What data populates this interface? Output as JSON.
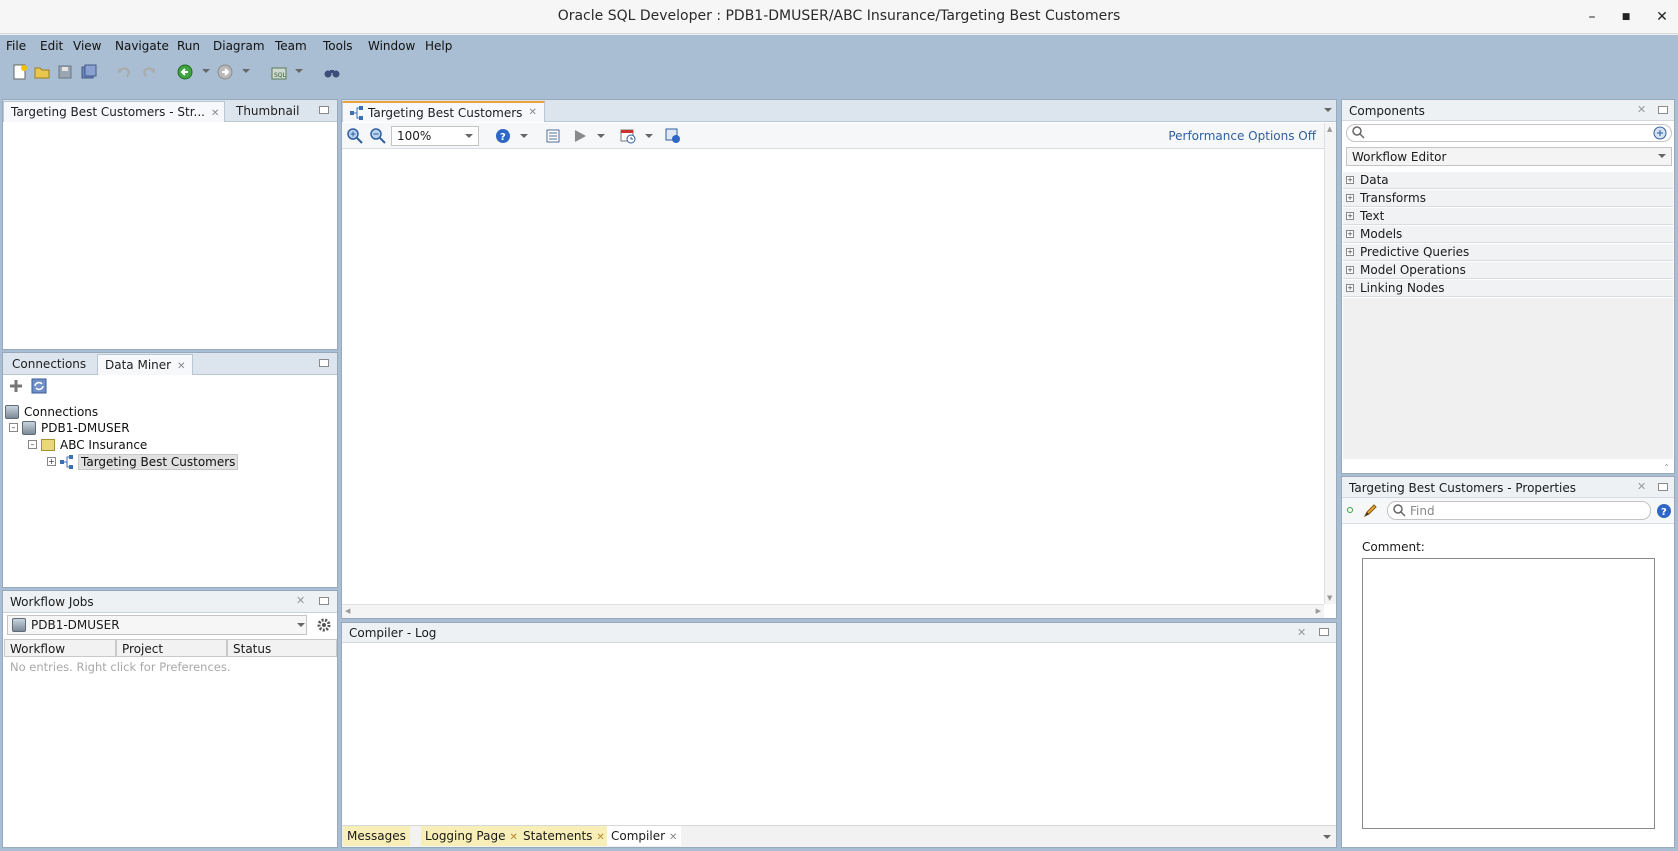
{
  "window": {
    "title": "Oracle SQL Developer : PDB1-DMUSER/ABC Insurance/Targeting Best Customers",
    "controls": {
      "minimize": "–",
      "maximize": "■",
      "close": "✕"
    }
  },
  "menu": [
    "File",
    "Edit",
    "View",
    "Navigate",
    "Run",
    "Diagram",
    "Team",
    "Tools",
    "Window",
    "Help"
  ],
  "toolbar_icons": [
    "new-icon",
    "open-icon",
    "save-icon",
    "save-all-icon",
    "undo-icon",
    "redo-icon",
    "back-icon",
    "forward-icon",
    "sql-worksheet-icon",
    "binoculars-icon"
  ],
  "structure_panel": {
    "tabs": [
      "Targeting Best Customers - Str...",
      "Thumbnail"
    ]
  },
  "navigator_panel": {
    "tabs": [
      "Connections",
      "Data Miner"
    ],
    "tree": [
      {
        "label": "Connections"
      },
      {
        "label": "PDB1-DMUSER"
      },
      {
        "label": "ABC Insurance"
      },
      {
        "label": "Targeting Best Customers"
      }
    ]
  },
  "workflow_jobs": {
    "title": "Workflow Jobs",
    "connection": "PDB1-DMUSER",
    "columns": [
      "Workflow",
      "Project",
      "Status"
    ],
    "empty_message": "No entries. Right click for Preferences."
  },
  "editor": {
    "tab": "Targeting Best Customers",
    "zoom": "100%",
    "performance_options": "Performance Options Off"
  },
  "log": {
    "title": "Compiler - Log",
    "bottom_tabs": [
      "Messages",
      "Logging Page",
      "Statements",
      "Compiler"
    ]
  },
  "components": {
    "title": "Components",
    "palette": "Workflow Editor",
    "categories": [
      "Data",
      "Transforms",
      "Text",
      "Models",
      "Predictive Queries",
      "Model Operations",
      "Linking Nodes"
    ]
  },
  "properties": {
    "title": "Targeting Best Customers - Properties",
    "find_placeholder": "Find",
    "comment_label": "Comment:"
  },
  "colors": {
    "chrome": "#a9bed2",
    "link": "#2f5f9f",
    "active_tab_accent": "#e8a33b"
  }
}
